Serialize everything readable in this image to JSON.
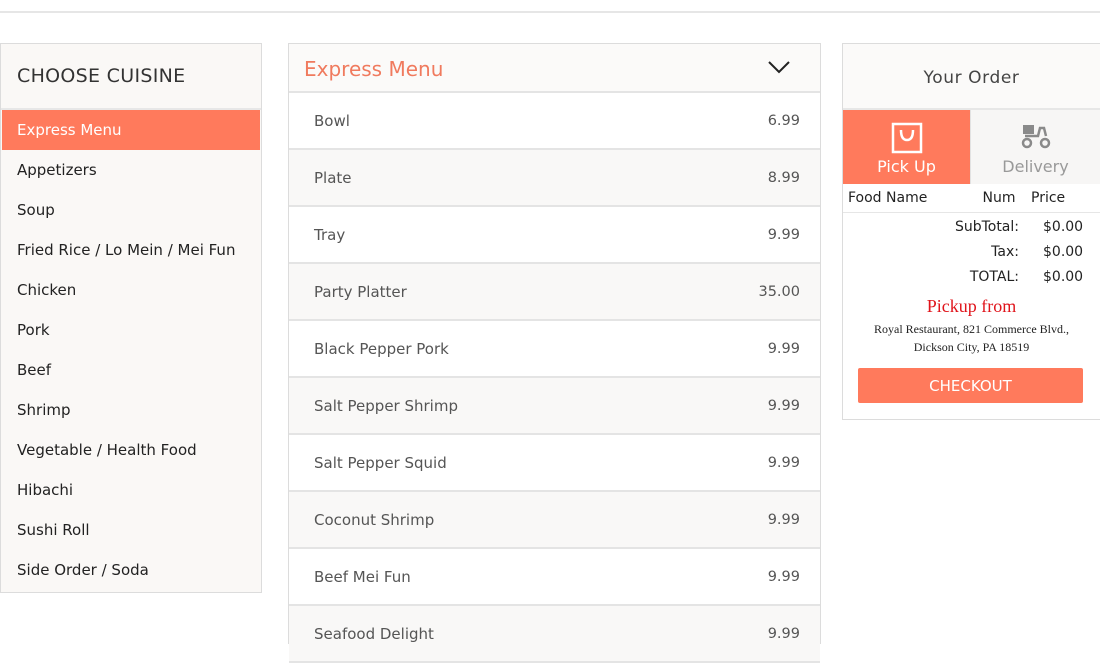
{
  "cuisine": {
    "heading": "CHOOSE CUISINE",
    "items": [
      {
        "label": "Express Menu",
        "active": true
      },
      {
        "label": "Appetizers"
      },
      {
        "label": "Soup"
      },
      {
        "label": "Fried Rice / Lo Mein / Mei Fun"
      },
      {
        "label": "Chicken"
      },
      {
        "label": "Pork"
      },
      {
        "label": "Beef"
      },
      {
        "label": "Shrimp"
      },
      {
        "label": "Vegetable / Health Food"
      },
      {
        "label": "Hibachi"
      },
      {
        "label": "Sushi Roll"
      },
      {
        "label": "Side Order / Soda"
      }
    ]
  },
  "menu": {
    "title": "Express Menu",
    "toggle_icon": "chevron-down-icon",
    "items": [
      {
        "name": "Bowl",
        "price": "6.99"
      },
      {
        "name": "Plate",
        "price": "8.99"
      },
      {
        "name": "Tray",
        "price": "9.99"
      },
      {
        "name": "Party Platter",
        "price": "35.00"
      },
      {
        "name": "Black Pepper Pork",
        "price": "9.99"
      },
      {
        "name": "Salt Pepper Shrimp",
        "price": "9.99"
      },
      {
        "name": "Salt Pepper Squid",
        "price": "9.99"
      },
      {
        "name": "Coconut Shrimp",
        "price": "9.99"
      },
      {
        "name": "Beef Mei Fun",
        "price": "9.99"
      },
      {
        "name": "Seafood Delight",
        "price": "9.99"
      }
    ]
  },
  "order": {
    "title": "Your Order",
    "modes": {
      "pickup": {
        "label": "Pick Up",
        "icon": "shopping-bag-icon",
        "selected": true
      },
      "delivery": {
        "label": "Delivery",
        "icon": "scooter-icon",
        "selected": false
      }
    },
    "columns": {
      "food": "Food Name",
      "num": "Num",
      "price": "Price"
    },
    "subtotal_label": "SubTotal:",
    "subtotal_value": "$0.00",
    "tax_label": "Tax:",
    "tax_value": "$0.00",
    "total_label": "TOTAL:",
    "total_value": "$0.00",
    "pickup_from": "Pickup from",
    "address_line1": "Royal Restaurant, 821 Commerce Blvd.,",
    "address_line2": "Dickson City, PA 18519",
    "checkout_label": "CHECKOUT"
  },
  "colors": {
    "accent": "#ff7a5c",
    "menu_title": "#f07a5e",
    "pickup_from": "#e0141b"
  }
}
